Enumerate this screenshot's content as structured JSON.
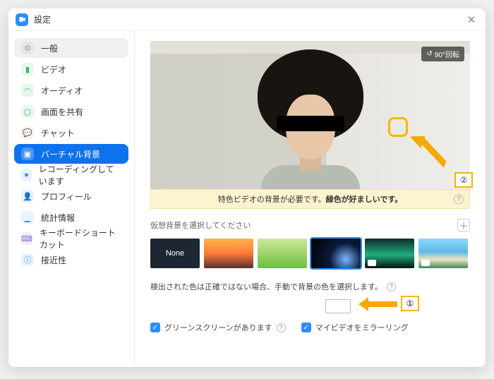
{
  "window_title": "設定",
  "sidebar": {
    "items": [
      {
        "label": "一般"
      },
      {
        "label": "ビデオ"
      },
      {
        "label": "オーディオ"
      },
      {
        "label": "画面を共有"
      },
      {
        "label": "チャット"
      },
      {
        "label": "バーチャル背景"
      },
      {
        "label": "レコーディングしています"
      },
      {
        "label": "プロフィール"
      },
      {
        "label": "統計情報"
      },
      {
        "label": "キーボードショートカット"
      },
      {
        "label": "接近性"
      }
    ]
  },
  "rotate_label": "90°回転",
  "warning_text_prefix": "特色ビデオの背景が必要です。",
  "warning_text_emph": "緑色が好ましいです。",
  "choose_bg_label": "仮想背景を選択してください",
  "thumb_none": "None",
  "manual_color_text": "検出された色は正確ではない場合、手動で背景の色を選択します。",
  "greenscreen_label": "グリーンスクリーンがあります",
  "mirror_label": "マイビデオをミラーリング",
  "annotation1": "①",
  "annotation2": "②"
}
